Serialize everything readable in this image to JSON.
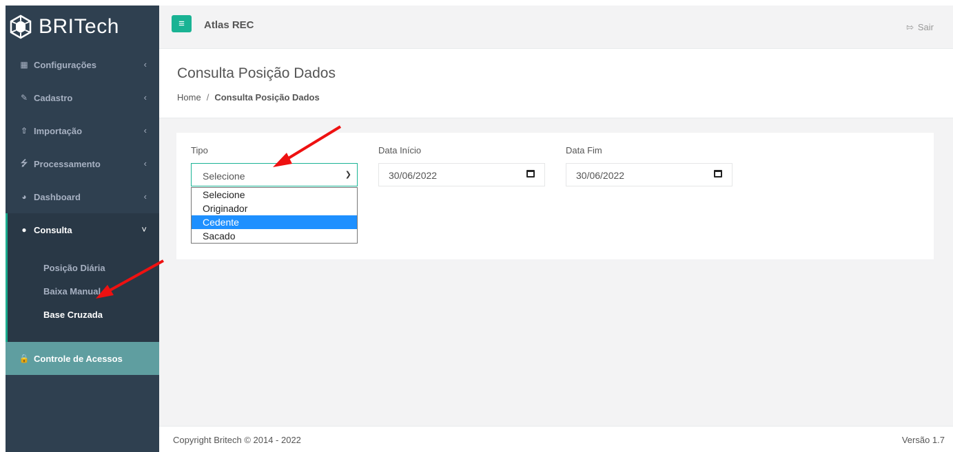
{
  "brand": {
    "name": "BRITech"
  },
  "sidebar": {
    "items": [
      {
        "label": "Configurações",
        "icon": "grid-icon"
      },
      {
        "label": "Cadastro",
        "icon": "edit-icon"
      },
      {
        "label": "Importação",
        "icon": "upload-icon"
      },
      {
        "label": "Processamento",
        "icon": "bolt-icon"
      },
      {
        "label": "Dashboard",
        "icon": "pie-chart-icon"
      },
      {
        "label": "Consulta",
        "icon": "binoculars-icon"
      }
    ],
    "consulta_sub": [
      {
        "label": "Posição Diária"
      },
      {
        "label": "Baixa Manual"
      },
      {
        "label": "Base Cruzada"
      }
    ],
    "access_control": {
      "label": "Controle de Acessos",
      "icon": "lock-icon"
    }
  },
  "header": {
    "app_title": "Atlas REC",
    "logout_label": "Sair"
  },
  "page": {
    "title": "Consulta Posição Dados",
    "breadcrumb": {
      "home": "Home",
      "sep": "/",
      "current": "Consulta Posição Dados"
    }
  },
  "form": {
    "tipo": {
      "label": "Tipo",
      "value": "Selecione",
      "options": [
        "Selecione",
        "Originador",
        "Cedente",
        "Sacado"
      ],
      "highlighted": "Cedente"
    },
    "data_inicio": {
      "label": "Data Início",
      "value": "30/06/2022"
    },
    "data_fim": {
      "label": "Data Fim",
      "value": "30/06/2022"
    }
  },
  "footer": {
    "copyright": "Copyright Britech © 2014 - 2022",
    "version": "Versão 1.7"
  },
  "colors": {
    "accent": "#1ab394",
    "sidebar": "#2f4050",
    "highlight": "#1e90ff",
    "annotation_arrow": "#ee1111"
  }
}
